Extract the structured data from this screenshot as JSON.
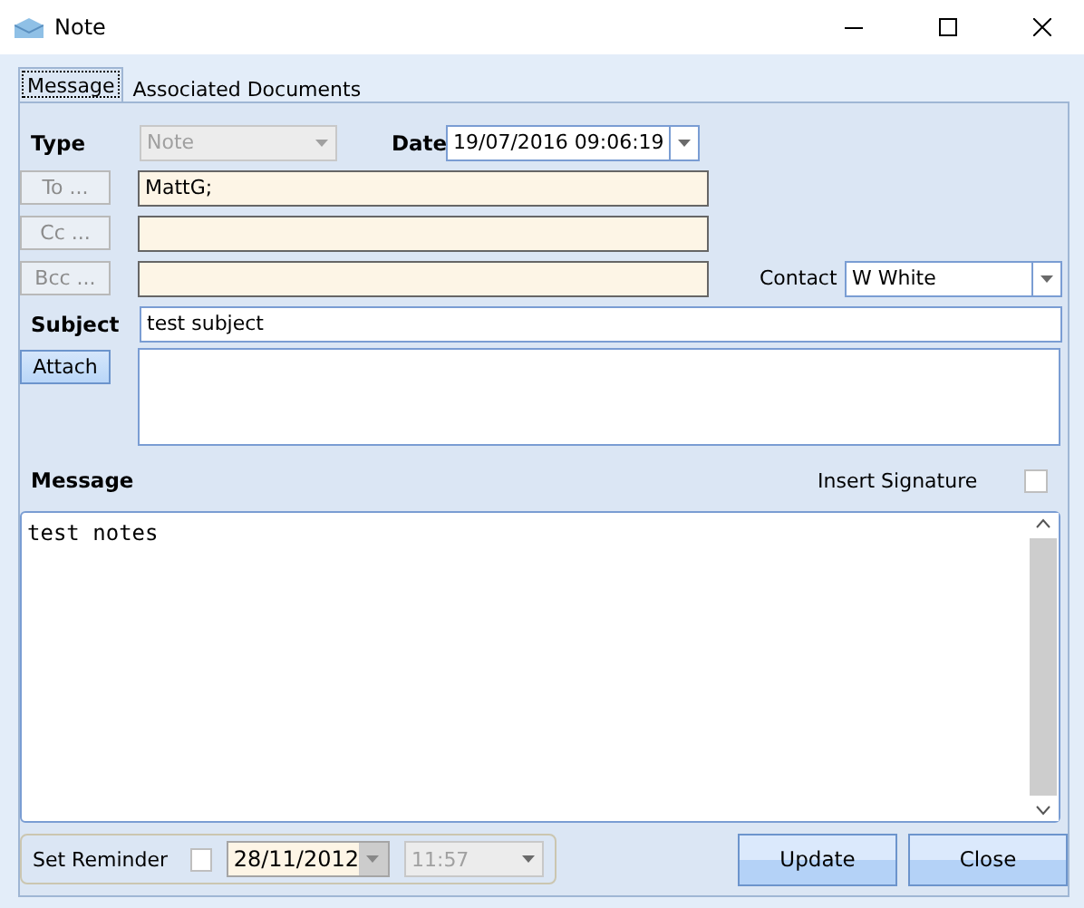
{
  "window": {
    "title": "Note"
  },
  "tabs": [
    {
      "label": "Message",
      "selected": true
    },
    {
      "label": "Associated Documents",
      "selected": false
    }
  ],
  "type": {
    "label": "Type",
    "value": "Note",
    "disabled": true
  },
  "date": {
    "label": "Date",
    "value": "19/07/2016 09:06:19"
  },
  "recipients": [
    {
      "button": "To ...",
      "value": "MattG;"
    },
    {
      "button": "Cc ..."
    },
    {
      "button": "Bcc ..."
    }
  ],
  "contact": {
    "label": "Contact",
    "value": "W White"
  },
  "subject": {
    "label": "Subject",
    "value": "test subject"
  },
  "attach": {
    "button": "Attach"
  },
  "message": {
    "label": "Message",
    "value": "test notes"
  },
  "insert_signature": {
    "label": "Insert Signature",
    "checked": false
  },
  "reminder": {
    "label": "Set Reminder",
    "checked": false,
    "date": "28/11/2012",
    "time": "11:57"
  },
  "buttons": [
    "Update",
    "Close"
  ]
}
